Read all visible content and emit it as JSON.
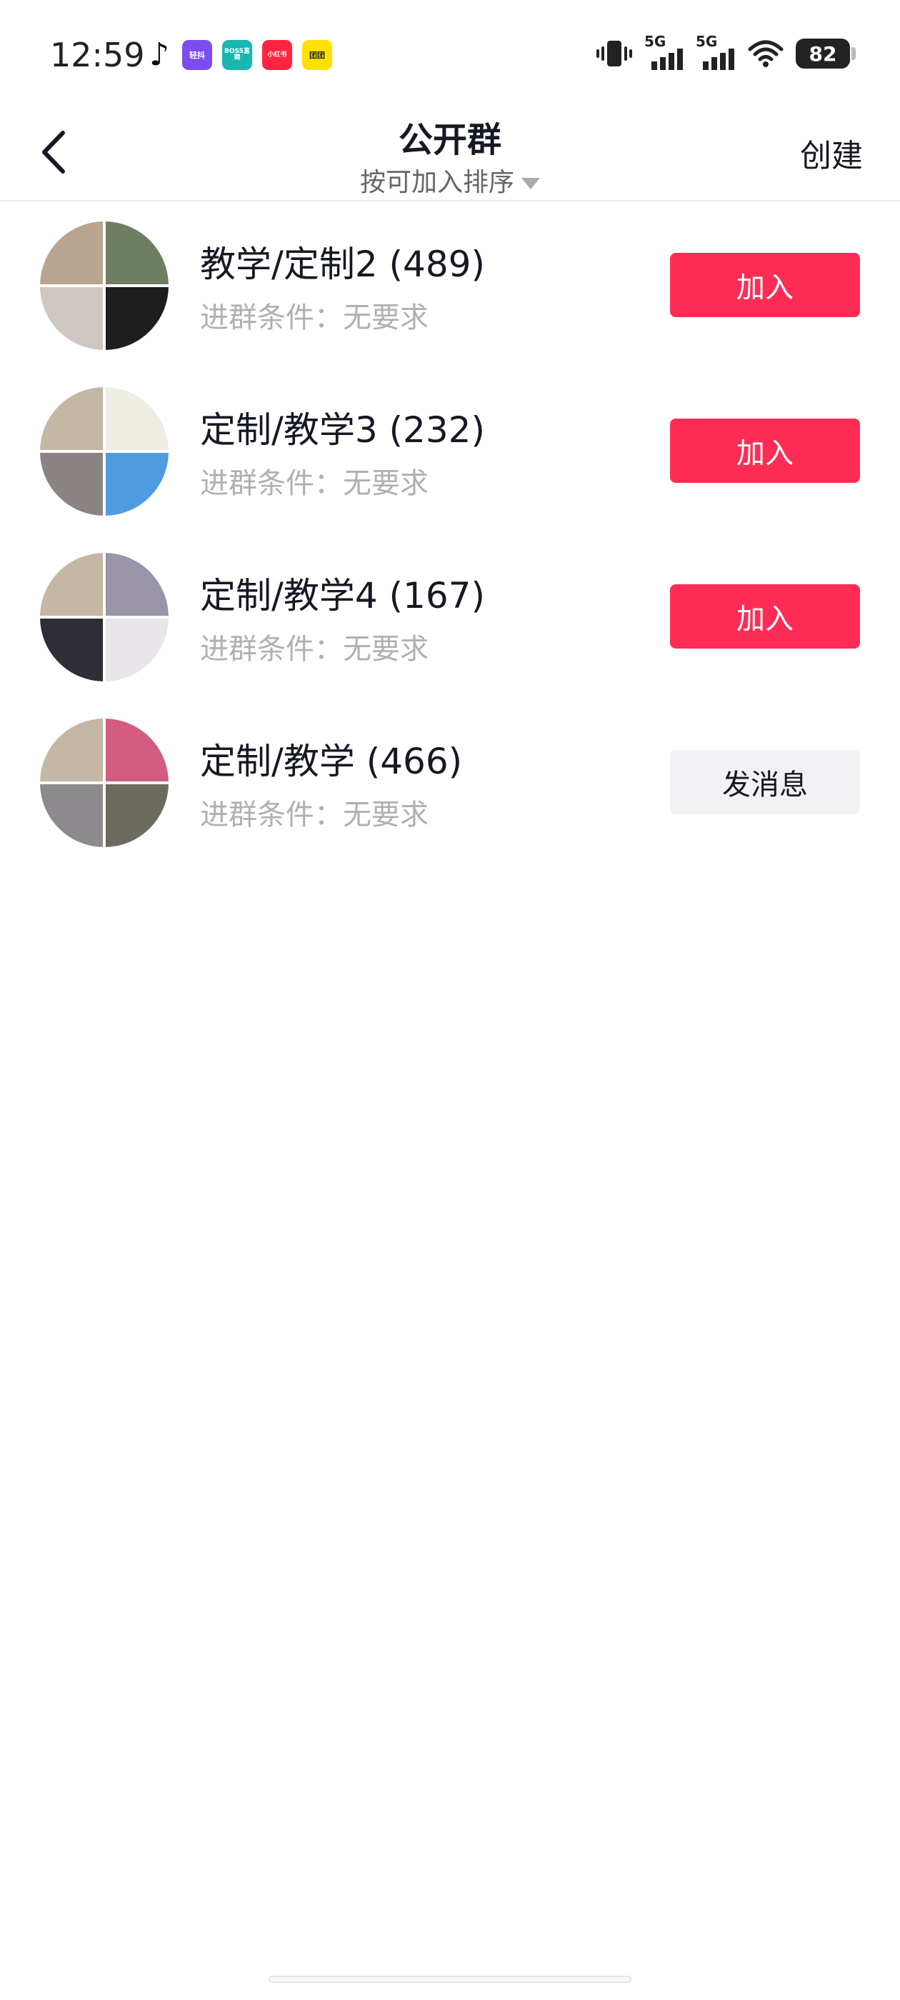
{
  "status_bar": {
    "time": "12:59",
    "apps": [
      {
        "name": "tiktok-icon",
        "label": "♪",
        "cls": "tiktok"
      },
      {
        "name": "qingdou-icon",
        "label": "轻抖",
        "cls": "qingdou"
      },
      {
        "name": "boss-icon",
        "label": "BOSS直聘",
        "cls": "boss"
      },
      {
        "name": "xiaohongshu-icon",
        "label": "小红书",
        "cls": "xhs"
      },
      {
        "name": "meituan-icon",
        "label": "团团",
        "cls": "yellow"
      }
    ],
    "network_1": "5G",
    "network_2": "5G",
    "battery": "82"
  },
  "header": {
    "title": "公开群",
    "sort_label": "按可加入排序",
    "create_label": "创建"
  },
  "groups": [
    {
      "name": "教学/定制2 (489)",
      "condition": "进群条件：无要求",
      "action": "加入",
      "action_type": "join",
      "avatar_colors": [
        "#b9a58f",
        "#6f7d62",
        "#cfc7c2",
        "#1e1e1e"
      ]
    },
    {
      "name": "定制/教学3 (232)",
      "condition": "进群条件：无要求",
      "action": "加入",
      "action_type": "join",
      "avatar_colors": [
        "#c4b7a4",
        "#efece4",
        "#8a8583",
        "#4f9be0"
      ]
    },
    {
      "name": "定制/教学4 (167)",
      "condition": "进群条件：无要求",
      "action": "加入",
      "action_type": "join",
      "avatar_colors": [
        "#c4b7a4",
        "#9a95a8",
        "#2f2d36",
        "#e8e6ea"
      ]
    },
    {
      "name": "定制/教学 (466)",
      "condition": "进群条件：无要求",
      "action": "发消息",
      "action_type": "message",
      "avatar_colors": [
        "#c4b7a4",
        "#d45c80",
        "#8c8a8c",
        "#6d6a5f"
      ]
    }
  ],
  "colors": {
    "accent": "#fe2c55",
    "message_button": "#f2f2f4",
    "secondary_text": "#b0b0b3"
  }
}
